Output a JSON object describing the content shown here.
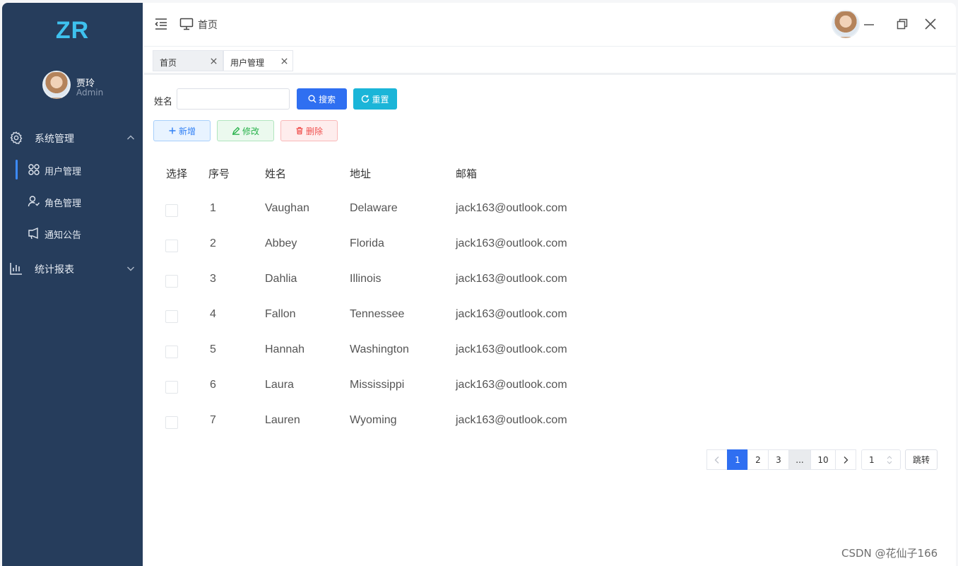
{
  "sidebar": {
    "brand": "ZR",
    "user": {
      "name": "贾玲",
      "role": "Admin"
    },
    "groups": [
      {
        "label": "系统管理",
        "expanded": true
      },
      {
        "label": "统计报表",
        "expanded": false
      }
    ],
    "sub_items": [
      {
        "label": "用户管理",
        "active": true
      },
      {
        "label": "角色管理",
        "active": false
      },
      {
        "label": "通知公告",
        "active": false
      }
    ]
  },
  "header": {
    "breadcrumb": "首页"
  },
  "tabs": [
    {
      "label": "首页",
      "active": false
    },
    {
      "label": "用户管理",
      "active": true
    }
  ],
  "search": {
    "label": "姓名",
    "value": "",
    "placeholder": ""
  },
  "buttons": {
    "search": "搜索",
    "reset": "重置",
    "add": "新增",
    "edit": "修改",
    "delete": "删除",
    "jump": "跳转"
  },
  "table": {
    "headers": [
      "选择",
      "序号",
      "姓名",
      "地址",
      "邮箱"
    ],
    "rows": [
      {
        "id": "1",
        "name": "Vaughan",
        "address": "Delaware",
        "email": "jack163@outlook.com"
      },
      {
        "id": "2",
        "name": "Abbey",
        "address": "Florida",
        "email": "jack163@outlook.com"
      },
      {
        "id": "3",
        "name": "Dahlia",
        "address": "Illinois",
        "email": "jack163@outlook.com"
      },
      {
        "id": "4",
        "name": "Fallon",
        "address": "Tennessee",
        "email": "jack163@outlook.com"
      },
      {
        "id": "5",
        "name": "Hannah",
        "address": "Washington",
        "email": "jack163@outlook.com"
      },
      {
        "id": "6",
        "name": "Laura",
        "address": "Mississippi",
        "email": "jack163@outlook.com"
      },
      {
        "id": "7",
        "name": "Lauren",
        "address": "Wyoming",
        "email": "jack163@outlook.com"
      }
    ]
  },
  "pagination": {
    "pages": [
      "1",
      "2",
      "3",
      "...",
      "10"
    ],
    "current": "1",
    "jump_value": "1"
  },
  "watermark": "CSDN @花仙子166",
  "colors": {
    "sidebar_bg": "#263d5c",
    "brand": "#3ec1ee",
    "primary": "#2f6ff1",
    "reset": "#1bb5d8"
  }
}
